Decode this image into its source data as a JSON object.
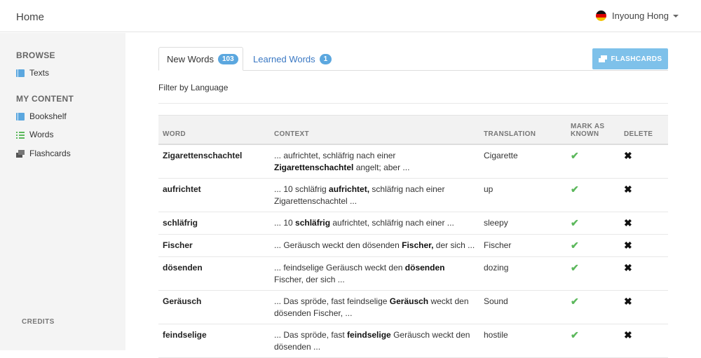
{
  "header": {
    "home": "Home",
    "user_name": "Inyoung Hong"
  },
  "sidebar": {
    "browse_title": "BROWSE",
    "browse_items": [
      {
        "label": "Texts",
        "icon": "book-icon"
      }
    ],
    "content_title": "MY CONTENT",
    "content_items": [
      {
        "label": "Bookshelf",
        "icon": "book-icon"
      },
      {
        "label": "Words",
        "icon": "list-icon"
      },
      {
        "label": "Flashcards",
        "icon": "cards-icon"
      }
    ],
    "credits": "CREDITS"
  },
  "tabs": [
    {
      "label": "New Words",
      "count": "103"
    },
    {
      "label": "Learned Words",
      "count": "1"
    }
  ],
  "flashcards_button": "FLASHCARDS",
  "filter_label": "Filter by Language",
  "table": {
    "columns": [
      "WORD",
      "CONTEXT",
      "TRANSLATION",
      "MARK AS KNOWN",
      "DELETE"
    ],
    "rows": [
      {
        "word": "Zigarettenschachtel",
        "ctx_before": "... aufrichtet, schläfrig nach einer ",
        "ctx_word": "Zigarettenschachtel",
        "ctx_after": " angelt; aber ...",
        "translation": "Cigarette"
      },
      {
        "word": "aufrichtet",
        "ctx_before": "... 10 schläfrig ",
        "ctx_word": "aufrichtet,",
        "ctx_after": " schläfrig nach einer Zigarettenschachtel ...",
        "translation": "up"
      },
      {
        "word": "schläfrig",
        "ctx_before": "... 10 ",
        "ctx_word": "schläfrig",
        "ctx_after": " aufrichtet, schläfrig nach einer ...",
        "translation": "sleepy"
      },
      {
        "word": "Fischer",
        "ctx_before": "... Geräusch weckt den dösenden ",
        "ctx_word": "Fischer,",
        "ctx_after": " der sich ...",
        "translation": "Fischer"
      },
      {
        "word": "dösenden",
        "ctx_before": "... feindselige Geräusch weckt den ",
        "ctx_word": "dösenden",
        "ctx_after": " Fischer, der sich ...",
        "translation": "dozing"
      },
      {
        "word": "Geräusch",
        "ctx_before": "... Das spröde, fast feindselige ",
        "ctx_word": "Geräusch",
        "ctx_after": " weckt den dösenden Fischer, ...",
        "translation": "Sound"
      },
      {
        "word": "feindselige",
        "ctx_before": "... Das spröde, fast ",
        "ctx_word": "feindselige",
        "ctx_after": " Geräusch weckt den dösenden ...",
        "translation": "hostile"
      }
    ],
    "check_glyph": "✔",
    "delete_glyph": "✖"
  },
  "colors": {
    "accent": "#5ba7df",
    "button": "#7ec1ea",
    "check": "#5cb85c",
    "link": "#3a78c3"
  }
}
